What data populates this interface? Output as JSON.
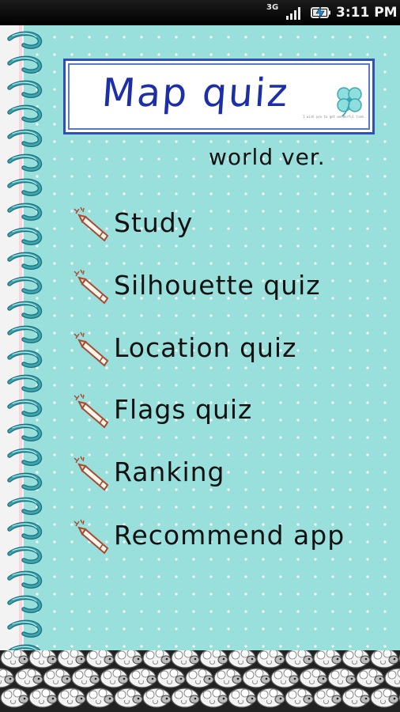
{
  "status_bar": {
    "network": "3G",
    "time": "3:11 PM",
    "icons": [
      "signal-icon",
      "battery-charging-icon"
    ]
  },
  "header": {
    "title": "Map quiz",
    "tagline": "I wish you to get wonderful time.",
    "subtitle": "world ver."
  },
  "menu": {
    "items": [
      {
        "label": "Study",
        "icon": "pencil-icon"
      },
      {
        "label": "Silhouette quiz",
        "icon": "pencil-icon"
      },
      {
        "label": "Location quiz",
        "icon": "pencil-icon"
      },
      {
        "label": "Flags quiz",
        "icon": "pencil-icon"
      },
      {
        "label": "Ranking",
        "icon": "pencil-icon"
      },
      {
        "label": "Recommend app",
        "icon": "pencil-icon"
      }
    ]
  },
  "colors": {
    "paper": "#99dfdc",
    "title_border": "#3050b8",
    "title_text": "#1c2fa8",
    "spiral": "#3aa6b2",
    "pencil": "#a84a30"
  },
  "banner": {
    "icon": "sheep-icon"
  }
}
